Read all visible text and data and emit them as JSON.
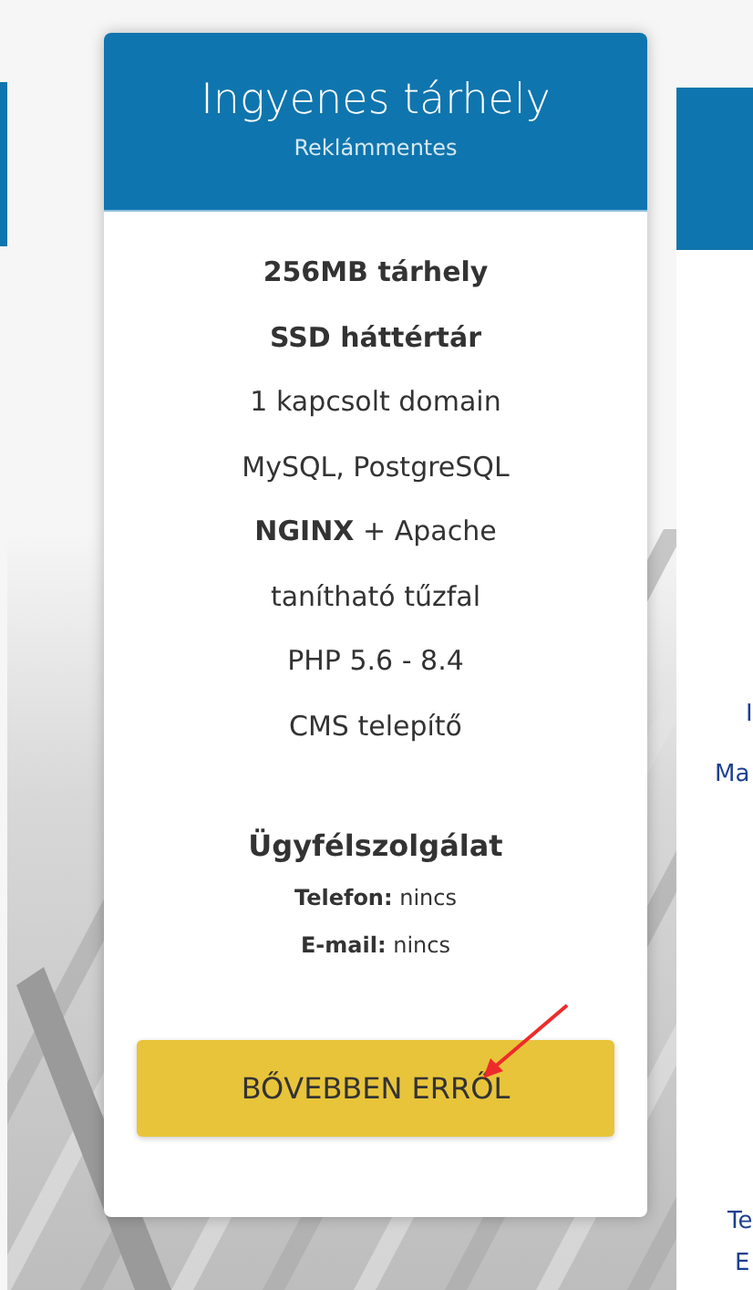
{
  "main_plan": {
    "title": "Ingyenes tárhely",
    "subtitle": "Reklámmentes",
    "features": [
      {
        "text": "256MB tárhely",
        "kind": "bold"
      },
      {
        "text": "SSD háttértár",
        "kind": "bold"
      },
      {
        "text": "1 kapcsolt domain",
        "kind": "plain"
      },
      {
        "text": "MySQL, PostgreSQL",
        "kind": "plain"
      },
      {
        "text": "**NGINX** + Apache",
        "kind": "plain"
      },
      {
        "text": "tanítható tűzfal",
        "kind": "plain"
      },
      {
        "text": "PHP 5.6 - 8.4",
        "kind": "plain"
      },
      {
        "text": "CMS telepítő",
        "kind": "plain"
      }
    ],
    "support": {
      "heading": "Ügyfélszolgálat",
      "lines": [
        "**Telefon:** nincs",
        "**E-mail:** nincs"
      ]
    },
    "button": "BŐVEBBEN ERRŐL"
  },
  "right_plan": {
    "fragments": [
      "I",
      "Ma",
      "Te",
      "E"
    ]
  }
}
